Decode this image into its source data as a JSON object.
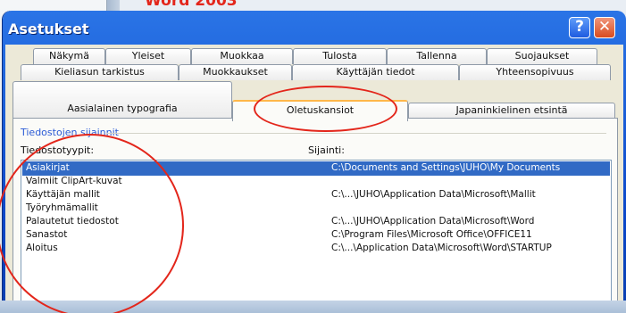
{
  "background": {
    "heading": "Word 2003"
  },
  "window": {
    "title": "Asetukset",
    "help_button": "?",
    "close_button": "✕"
  },
  "tabs": {
    "row1": [
      "Näkymä",
      "Yleiset",
      "Muokkaa",
      "Tulosta",
      "Tallenna",
      "Suojaukset"
    ],
    "row2": [
      "Kieliasun tarkistus",
      "Muokkaukset",
      "Käyttäjän tiedot",
      "Yhteensopivuus"
    ],
    "row3": [
      "Aasialainen typografia",
      "Oletuskansiot",
      "Japaninkielinen etsintä"
    ],
    "active": "Oletuskansiot"
  },
  "panel": {
    "group_title": "Tiedostojen sijainnit",
    "col_types_label": "Tiedostotyypit:",
    "col_location_label": "Sijainti:",
    "rows": [
      {
        "type": "Asiakirjat",
        "location": "C:\\Documents and Settings\\JUHO\\My Documents",
        "selected": true
      },
      {
        "type": "Valmiit ClipArt-kuvat",
        "location": "",
        "selected": false
      },
      {
        "type": "Käyttäjän mallit",
        "location": "C:\\...\\JUHO\\Application Data\\Microsoft\\Mallit",
        "selected": false
      },
      {
        "type": "Työryhmämallit",
        "location": "",
        "selected": false
      },
      {
        "type": "Palautetut tiedostot",
        "location": "C:\\...\\JUHO\\Application Data\\Microsoft\\Word",
        "selected": false
      },
      {
        "type": "Sanastot",
        "location": "C:\\Program Files\\Microsoft Office\\OFFICE11",
        "selected": false
      },
      {
        "type": "Aloitus",
        "location": "C:\\...\\Application Data\\Microsoft\\Word\\STARTUP",
        "selected": false
      }
    ]
  },
  "colors": {
    "titlebar": "#0a46c8",
    "dialog_bg": "#ece9d8",
    "selection": "#316ac5",
    "annotation_red": "#e3261b",
    "group_title": "#2b5bd6"
  }
}
